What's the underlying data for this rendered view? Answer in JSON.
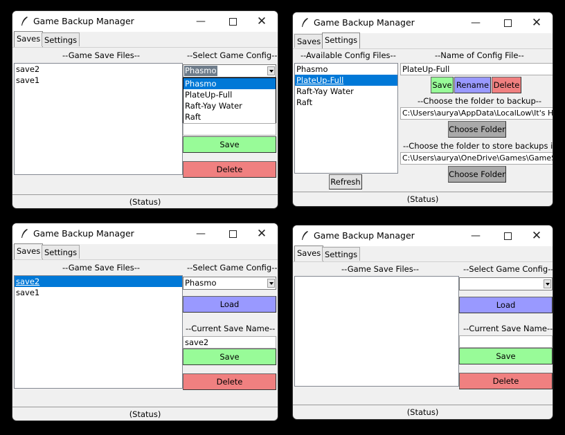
{
  "app": {
    "title": "Game Backup Manager",
    "min_glyph": "—",
    "close_glyph": "✕",
    "status": "(Status)"
  },
  "tabs": {
    "saves": "Saves",
    "settings": "Settings"
  },
  "labels": {
    "game_save_files": "--Game Save Files--",
    "select_game_config": "--Select Game Config--",
    "current_save_name": "--Current Save Name--",
    "available_config_files": "--Available Config Files--",
    "name_of_config_file": "--Name of Config File--",
    "choose_backup_folder": "--Choose the folder to backup--",
    "choose_store_folder": "--Choose the folder to store backups in--"
  },
  "buttons": {
    "save": "Save",
    "delete": "Delete",
    "load": "Load",
    "rename": "Rename",
    "choose_folder": "Choose Folder",
    "refresh": "Refresh"
  },
  "win1": {
    "save_files": [
      "save2",
      "save1"
    ],
    "config_selected": "Phasmo",
    "dropdown_options": [
      "Phasmo",
      "PlateUp-Full",
      "Raft-Yay Water",
      "Raft"
    ]
  },
  "win2": {
    "config_files": [
      "Phasmo",
      "PlateUp-Full",
      "Raft-Yay Water",
      "Raft"
    ],
    "config_name": "PlateUp-Full",
    "backup_folder": "C:\\Users\\aurya\\AppData\\LocalLow\\It's Ha",
    "store_folder": "C:\\Users\\aurya\\OneDrive\\Games\\GameSa"
  },
  "win3": {
    "save_files": [
      "save2",
      "save1"
    ],
    "config_selected": "Phasmo",
    "current_save_name": "save2"
  },
  "win4": {
    "save_files": [],
    "config_selected": "",
    "current_save_name": ""
  },
  "colors": {
    "save_button": "#98fb98",
    "delete_button": "#f08080",
    "load_button": "#9999ff",
    "choose_folder_button": "#a9a9a9",
    "selection": "#0078d7"
  }
}
